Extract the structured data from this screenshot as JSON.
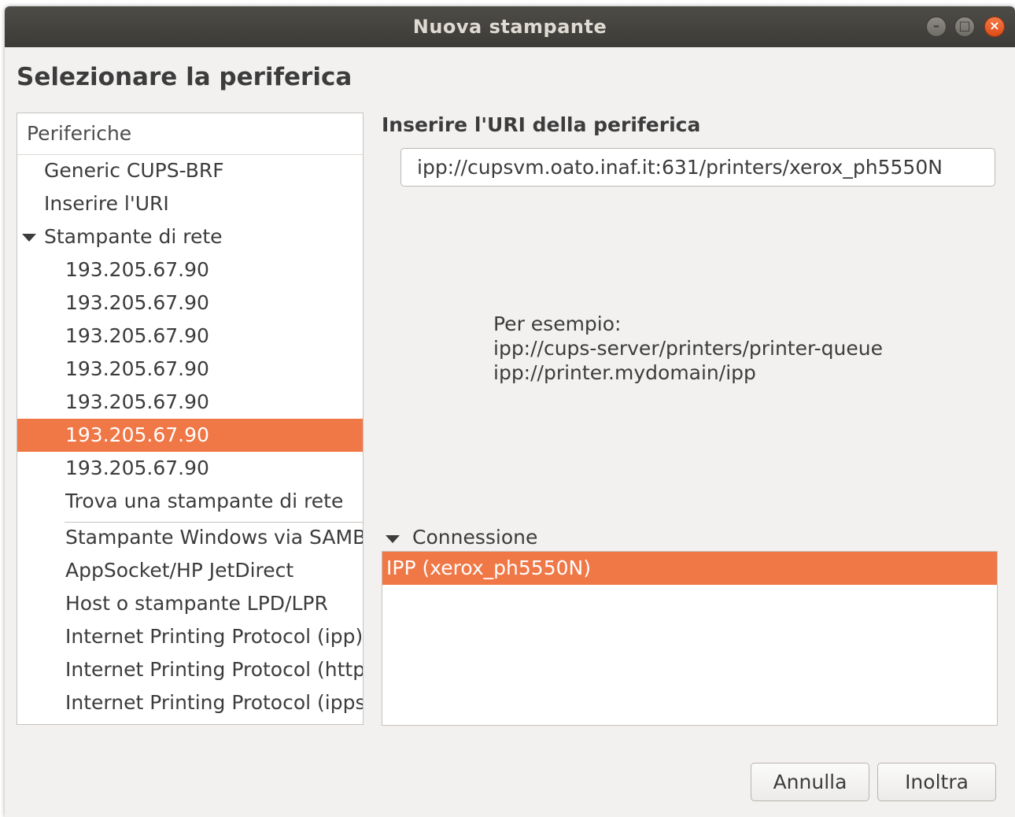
{
  "window": {
    "title": "Nuova stampante",
    "controls": {
      "minimize": "–",
      "maximize": "□",
      "close": "×"
    }
  },
  "page_title": "Selezionare la periferica",
  "devices": {
    "header": "Periferiche",
    "items": [
      {
        "label": "Generic CUPS-BRF",
        "level": 1
      },
      {
        "label": "Inserire l'URI",
        "level": 1
      },
      {
        "label": "Stampante di rete",
        "level": 1,
        "expanded": true
      },
      {
        "label": "193.205.67.90",
        "level": 2
      },
      {
        "label": "193.205.67.90",
        "level": 2
      },
      {
        "label": "193.205.67.90",
        "level": 2
      },
      {
        "label": "193.205.67.90",
        "level": 2
      },
      {
        "label": "193.205.67.90",
        "level": 2
      },
      {
        "label": "193.205.67.90",
        "level": 2,
        "selected": true
      },
      {
        "label": "193.205.67.90",
        "level": 2
      },
      {
        "label": "Trova una stampante di rete",
        "level": 2
      },
      {
        "label": "Stampante Windows via SAMBA",
        "level": 2
      },
      {
        "label": "AppSocket/HP JetDirect",
        "level": 2
      },
      {
        "label": "Host o stampante LPD/LPR",
        "level": 2
      },
      {
        "label": "Internet Printing Protocol (ipp)",
        "level": 2
      },
      {
        "label": "Internet Printing Protocol (http)",
        "level": 2
      },
      {
        "label": "Internet Printing Protocol (ipps)",
        "level": 2
      }
    ]
  },
  "uri": {
    "label": "Inserire l'URI della periferica",
    "value": "ipp://cupsvm.oato.inaf.it:631/printers/xerox_ph5550N"
  },
  "example": {
    "heading": "Per esempio:",
    "line1": "ipp://cups-server/printers/printer-queue",
    "line2": "ipp://printer.mydomain/ipp"
  },
  "connection": {
    "label": "Connessione",
    "items": [
      {
        "label": "IPP (xerox_ph5550N)",
        "selected": true
      }
    ]
  },
  "buttons": {
    "cancel": "Annulla",
    "forward": "Inoltra"
  },
  "colors": {
    "selection": "#f07746",
    "titlebar": "#3c3b37",
    "background": "#f2f1f0"
  }
}
